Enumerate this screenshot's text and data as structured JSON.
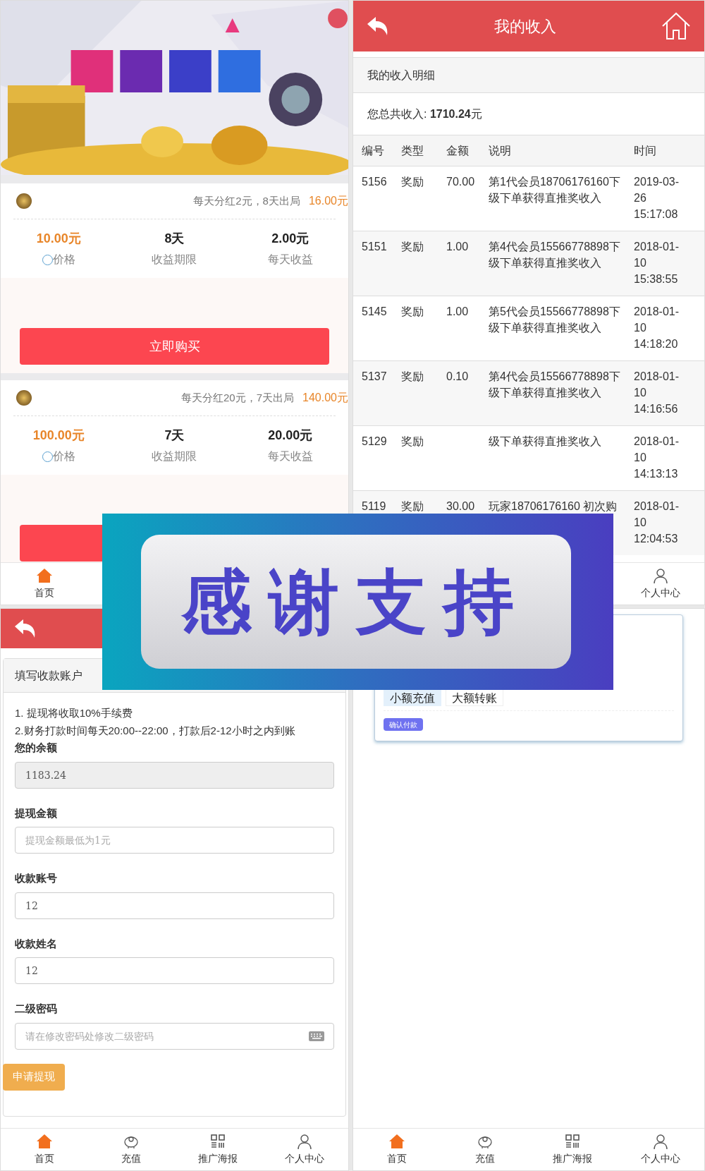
{
  "home_screen": {
    "products": [
      {
        "summary": "每天分红2元，8天出局",
        "total": "16.00元",
        "price": "10.00元",
        "price_label": "价格",
        "term": "8天",
        "term_label": "收益期限",
        "daily": "2.00元",
        "daily_label": "每天收益",
        "buy_button": "立即购买"
      },
      {
        "summary": "每天分红20元，7天出局",
        "total": "140.00元",
        "price": "100.00元",
        "price_label": "价格",
        "term": "7天",
        "term_label": "收益期限",
        "daily": "20.00元",
        "daily_label": "每天收益"
      }
    ],
    "tab_bar": [
      {
        "label": "首页",
        "selected": true
      }
    ]
  },
  "income_screen": {
    "title": "我的收入",
    "section_title": "我的收入明细",
    "total": "您总共收入: **1710.24**元",
    "columns": [
      "编号",
      "类型",
      "金额",
      "说明",
      "时间"
    ],
    "rows": [
      {
        "id": "5156",
        "type": "奖励",
        "amount": "70.00",
        "description": "第1代会员18706176160下级下单获得直推奖收入",
        "time": "2019-03-26 15:17:08"
      },
      {
        "id": "5151",
        "type": "奖励",
        "amount": "1.00",
        "description": "第4代会员15566778898下级下单获得直推奖收入",
        "time": "2018-01-10 15:38:55"
      },
      {
        "id": "5145",
        "type": "奖励",
        "amount": "1.00",
        "description": "第5代会员15566778898下级下单获得直推奖收入",
        "time": "2018-01-10 14:18:20"
      },
      {
        "id": "5137",
        "type": "奖励",
        "amount": "0.10",
        "description": "第4代会员15566778898下级下单获得直推奖收入",
        "time": "2018-01-10 14:16:56"
      },
      {
        "id": "5129",
        "type": "奖励",
        "description": "级下单获得直推奖收入",
        "time": "2018-01-10 14:13:13"
      },
      {
        "id": "5119",
        "type": "奖励",
        "amount": "30.00",
        "description": "玩家18706176160 初次购",
        "time": "2018-01-10 12:04:53"
      }
    ],
    "tab_bar": [
      {
        "label": "个人中心",
        "selected": false
      }
    ]
  },
  "withdraw_screen": {
    "section_title": "填写收款账户",
    "notes": [
      "1. 提现将收取10%手续费",
      "2.财务打款时间每天20:00--22:00，打款后2-12小时之内到账"
    ],
    "fields": [
      {
        "label": "您的余额",
        "value": "1183.24",
        "kind": "readonly"
      },
      {
        "label": "提现金额",
        "placeholder": "提现金额最低为1元",
        "kind": "text"
      },
      {
        "label": "收款账号",
        "value": "12",
        "kind": "text"
      },
      {
        "label": "收款姓名",
        "value": "12",
        "kind": "text"
      },
      {
        "label": "二级密码",
        "placeholder": "请在修改密码处修改二级密码",
        "kind": "password"
      }
    ],
    "submit_button": "申请提现",
    "tab_bar": [
      {
        "label": "首页",
        "selected": true
      },
      {
        "label": "充值",
        "selected": false
      },
      {
        "label": "推广海报",
        "selected": false
      },
      {
        "label": "个人中心",
        "selected": false
      }
    ]
  },
  "recharge_screen": {
    "tabs": [
      {
        "label": "小额充值",
        "selected": true
      },
      {
        "label": "大额转账",
        "selected": false
      }
    ],
    "confirm_button": "确认付款",
    "tab_bar": [
      {
        "label": "首页",
        "selected": true
      },
      {
        "label": "充值",
        "selected": false
      },
      {
        "label": "推广海报",
        "selected": false
      },
      {
        "label": "个人中心",
        "selected": false
      }
    ]
  },
  "overlay_banner": {
    "text": "感谢支持"
  }
}
